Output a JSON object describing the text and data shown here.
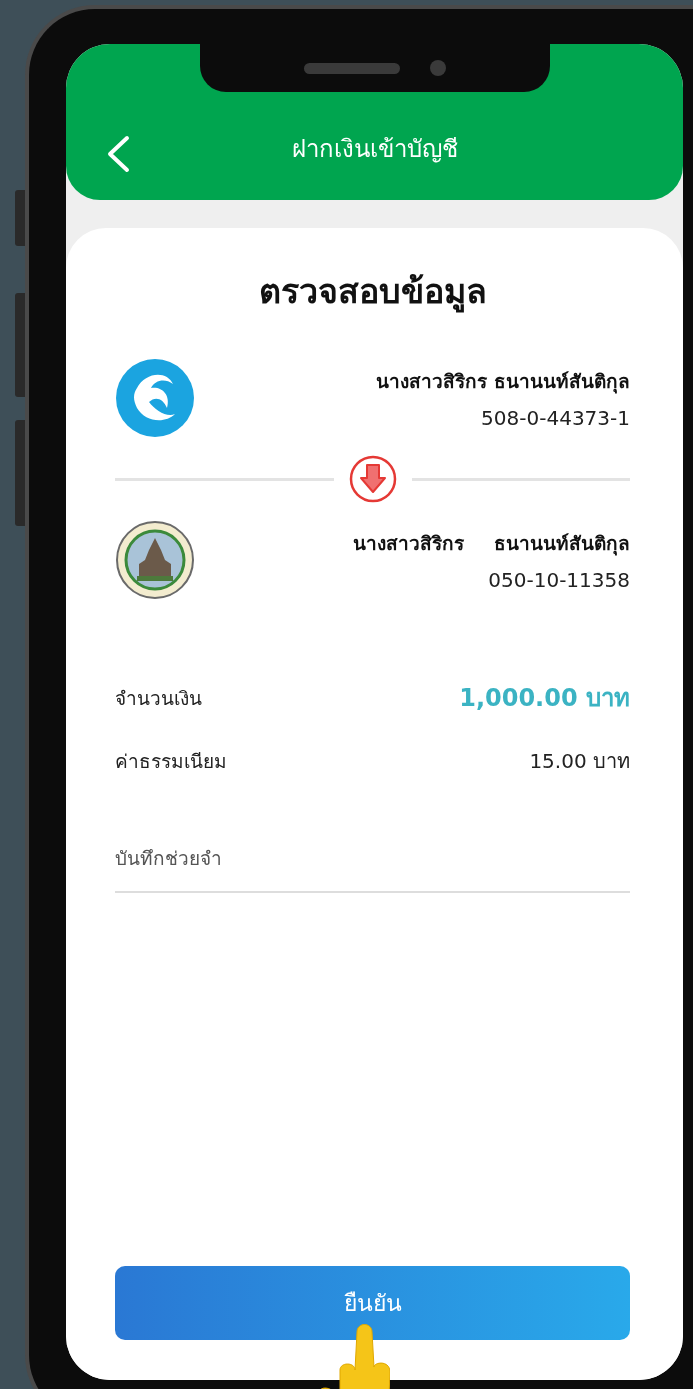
{
  "header": {
    "title": "ฝากเงินเข้าบัญชี"
  },
  "heading": "ตรวจสอบข้อมูล",
  "from": {
    "name": "นางสาวสิริกร ธนานนท์สันติกุล",
    "account": "508-0-44373-1"
  },
  "to": {
    "name_parts": [
      "นางสาวสิริกร",
      "ธนานนท์สันติกุล"
    ],
    "account": "050-10-11358"
  },
  "details": [
    {
      "label": "จำนวนเงิน",
      "value": "1,000.00 บาท",
      "kind": "highlight"
    },
    {
      "label": "ค่าธรรมเนียม",
      "value": "15.00 บาท",
      "kind": "plain"
    }
  ],
  "memo": {
    "placeholder": "บันทึกช่วยจำ"
  },
  "confirm_button": "ยืนยัน"
}
